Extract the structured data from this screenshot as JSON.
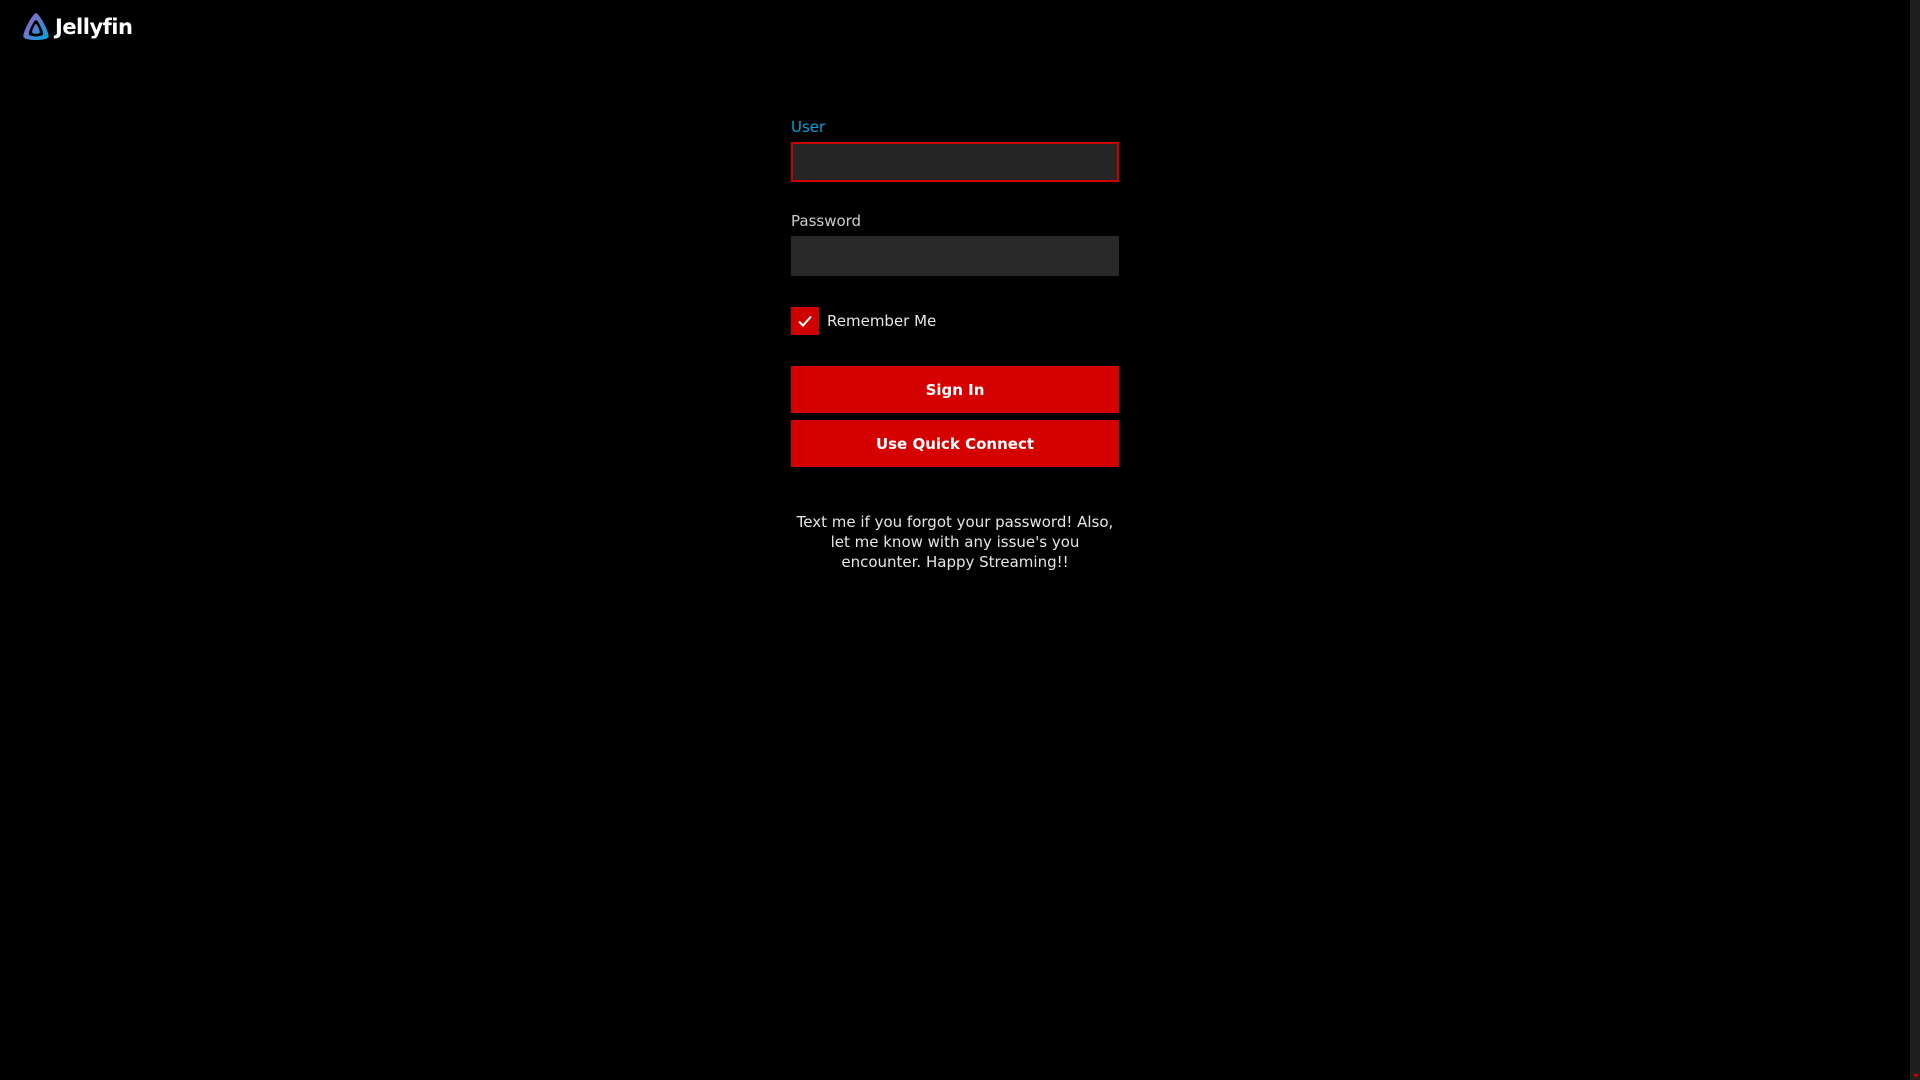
{
  "header": {
    "logo_icon": "jellyfin-logo-icon",
    "brand_name": "Jellyfin"
  },
  "login": {
    "user_label": "User",
    "user_value": "",
    "password_label": "Password",
    "password_value": "",
    "remember_me_label": "Remember Me",
    "remember_me_checked": true,
    "sign_in_label": "Sign In",
    "quick_connect_label": "Use Quick Connect",
    "disclaimer": "Text me if you forgot your password! Also, let me know with any issue's you encounter. Happy Streaming!!"
  },
  "colors": {
    "background": "#000000",
    "accent": "#d50000",
    "focus_label": "#00a4dc",
    "input_bg": "#292929"
  }
}
